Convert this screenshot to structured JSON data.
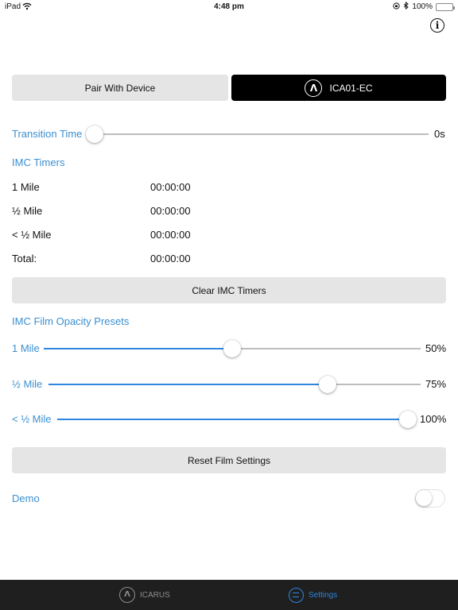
{
  "status_bar": {
    "carrier": "iPad",
    "time": "4:48 pm",
    "battery": "100%",
    "battery_level": 1.0
  },
  "header": {
    "info_label": "i"
  },
  "device": {
    "pair_label": "Pair With Device",
    "device_name": "ICA01-EC",
    "logo_glyph": "Λ"
  },
  "transition": {
    "label": "Transition Time",
    "value": "0s",
    "level": 0.0
  },
  "timers": {
    "title": "IMC Timers",
    "rows": [
      {
        "label": "1 Mile",
        "value": "00:00:00"
      },
      {
        "label": "½ Mile",
        "value": "00:00:00"
      },
      {
        "label": "< ½ Mile",
        "value": "00:00:00"
      },
      {
        "label": "Total:",
        "value": "00:00:00"
      }
    ],
    "clear_label": "Clear IMC Timers"
  },
  "presets": {
    "title": "IMC Film Opacity Presets",
    "items": [
      {
        "label": "1 Mile",
        "value": "50%",
        "level": 0.5
      },
      {
        "label": "½ Mile",
        "value": "75%",
        "level": 0.75
      },
      {
        "label": "< ½ Mile",
        "value": "100%",
        "level": 1.0
      }
    ],
    "reset_label": "Reset Film Settings"
  },
  "demo": {
    "label": "Demo",
    "on": false
  },
  "tabbar": {
    "tabs": [
      {
        "label": "ICARUS",
        "icon": "icarus-logo-icon",
        "active": false
      },
      {
        "label": "Settings",
        "icon": "settings-icon",
        "active": true
      }
    ]
  },
  "colors": {
    "accent": "#3b8fd1",
    "active_tab": "#2e86de",
    "tabbar_bg": "#1f1f1f",
    "button_bg": "#e5e5e5",
    "device_bg": "#000000",
    "battery": "#4cd964"
  }
}
